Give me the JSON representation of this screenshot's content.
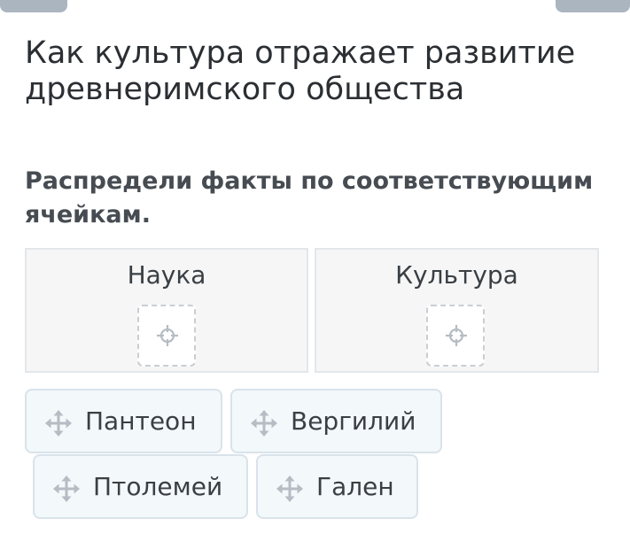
{
  "colors": {
    "tab_gray": "#aab5c0",
    "card_background": "#f3f8fb",
    "card_border": "#d9e3ea",
    "zone_background": "#f6f6f6",
    "icon_gray": "#b5bcc3"
  },
  "header": {
    "title": "Как культура отражает развитие древнеримского общества"
  },
  "task": {
    "instruction": "Распредели факты по соответствующим ячейкам."
  },
  "drop_zones": [
    {
      "label": "Наука",
      "slot_icon": "crosshair-icon"
    },
    {
      "label": "Культура",
      "slot_icon": "crosshair-icon"
    }
  ],
  "cards": [
    {
      "label": "Пантеон",
      "icon": "move-icon"
    },
    {
      "label": "Вергилий",
      "icon": "move-icon"
    },
    {
      "label": "Птолемей",
      "icon": "move-icon"
    },
    {
      "label": "Гален",
      "icon": "move-icon"
    }
  ]
}
